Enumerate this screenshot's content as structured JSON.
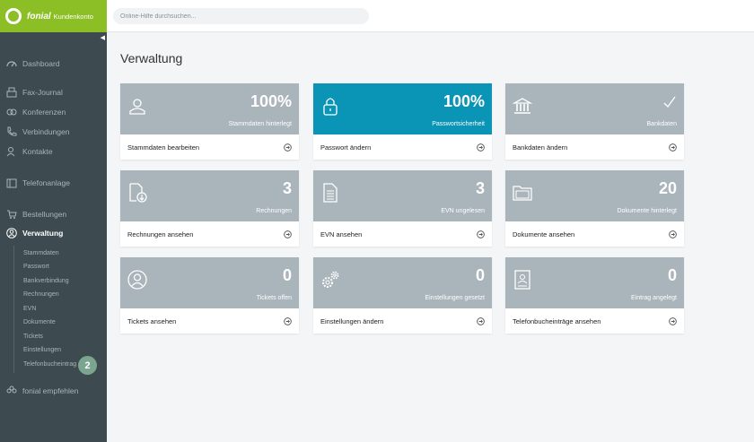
{
  "brand": {
    "name": "fonial",
    "sub": "Kundenkonto"
  },
  "search": {
    "placeholder": "Online-Hilfe durchsuchen..."
  },
  "nav": {
    "dashboard": "Dashboard",
    "fax": "Fax-Journal",
    "konferenzen": "Konferenzen",
    "verbindungen": "Verbindungen",
    "kontakte": "Kontakte",
    "telefonanlage": "Telefonanlage",
    "bestellungen": "Bestellungen",
    "verwaltung": "Verwaltung",
    "empfehlen": "fonial empfehlen"
  },
  "subnav": [
    "Stammdaten",
    "Passwort",
    "Bankverbindung",
    "Rechnungen",
    "EVN",
    "Dokumente",
    "Tickets",
    "Einstellungen",
    "Telefonbucheintrag"
  ],
  "badge": "2",
  "page": {
    "title": "Verwaltung"
  },
  "cards": [
    {
      "value": "100%",
      "caption": "Stammdaten hinterlegt",
      "action": "Stammdaten bearbeiten",
      "icon": "user-icon"
    },
    {
      "value": "100%",
      "caption": "Passwortsicherheit",
      "action": "Passwort ändern",
      "icon": "lock-icon"
    },
    {
      "value": "",
      "caption": "Bankdaten",
      "action": "Bankdaten ändern",
      "icon": "bank-icon"
    },
    {
      "value": "3",
      "caption": "Rechnungen",
      "action": "Rechnungen ansehen",
      "icon": "invoice-download-icon"
    },
    {
      "value": "3",
      "caption": "EVN ungelesen",
      "action": "EVN ansehen",
      "icon": "document-icon"
    },
    {
      "value": "20",
      "caption": "Dokumente hinterlegt",
      "action": "Dokumente ansehen",
      "icon": "folder-icon"
    },
    {
      "value": "0",
      "caption": "Tickets offen",
      "action": "Tickets ansehen",
      "icon": "support-icon"
    },
    {
      "value": "0",
      "caption": "Einstellungen gesetzt",
      "action": "Einstellungen ändern",
      "icon": "gears-icon"
    },
    {
      "value": "0",
      "caption": "Eintrag angelegt",
      "action": "Telefonbucheinträge ansehen",
      "icon": "phonebook-icon"
    }
  ],
  "colors": {
    "accent": "#8cbf26",
    "sidebar": "#3d4a4f",
    "card_grey": "#aab4bb",
    "card_blue": "#0a94b5"
  }
}
